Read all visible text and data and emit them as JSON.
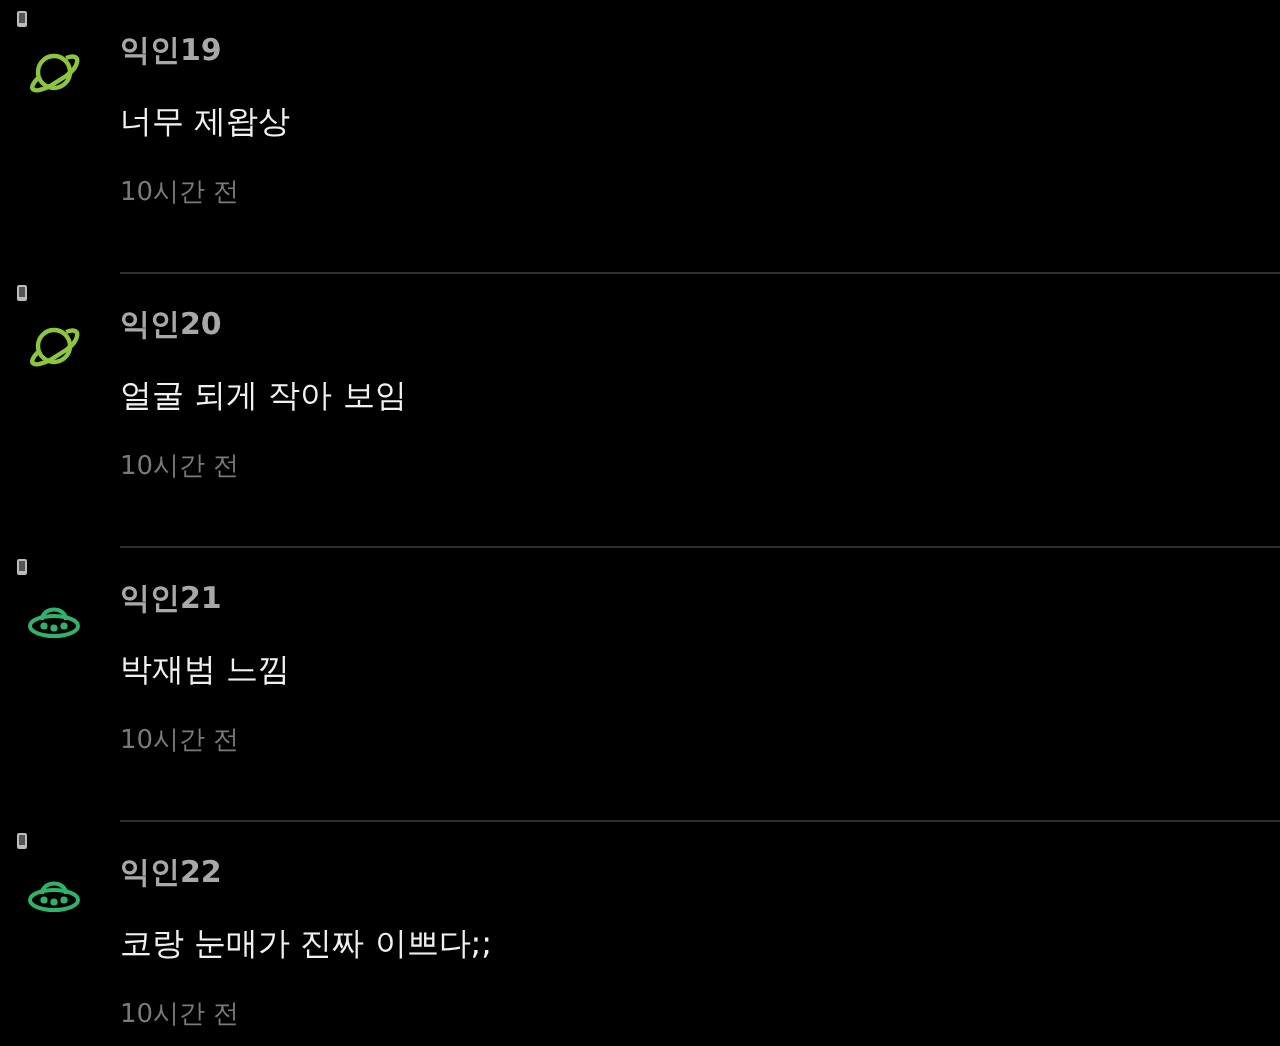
{
  "comments": [
    {
      "author": "익인19",
      "text": "너무 제왑상",
      "time": "10시간 전",
      "avatar": {
        "kind": "planet",
        "color": "#8cc63f"
      }
    },
    {
      "author": "익인20",
      "text": "얼굴 되게 작아 보임",
      "time": "10시간 전",
      "avatar": {
        "kind": "planet",
        "color": "#8cc63f"
      }
    },
    {
      "author": "익인21",
      "text": "박재범 느낌",
      "time": "10시간 전",
      "avatar": {
        "kind": "ufo",
        "color": "#2fb36a"
      }
    },
    {
      "author": "익인22",
      "text": "코랑 눈매가 진짜 이쁘다;;",
      "time": "10시간 전",
      "avatar": {
        "kind": "ufo",
        "color": "#2fb36a"
      }
    }
  ]
}
